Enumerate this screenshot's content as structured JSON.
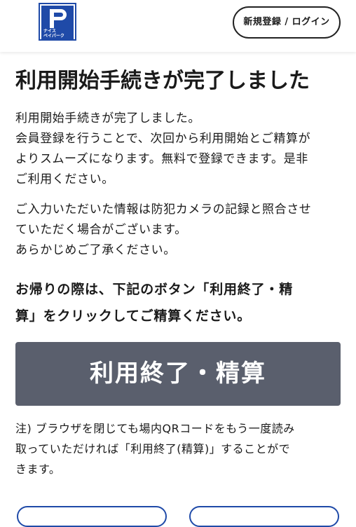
{
  "header": {
    "logo_text": "ナイス\nペイパーク",
    "login_label": "新規登録 / ログイン"
  },
  "main": {
    "title": "利用開始手続きが完了しました",
    "paragraph1": "利用開始手続きが完了しました。\n会員登録を行うことで、次回から利用開始とご精算が\nよりスムーズになります。無料で登録できます。是非\nご利用ください。",
    "paragraph2": "ご入力いただいた情報は防犯カメラの記録と照合させ\nていただく場合がございます。\nあらかじめご了承ください。",
    "emphasis": "お帰りの際は、下記のボタン「利用終了・精\n算」をクリックしてご精算ください。",
    "end_button_label": "利用終了・精算",
    "note": "注) ブラウザを閉じても場内QRコードをもう一度読み\n取っていただければ「利用終了(精算)」することがで\nきます。"
  },
  "colors": {
    "brand_blue": "#1f4aa8",
    "end_button_bg": "#5a5f6d"
  }
}
